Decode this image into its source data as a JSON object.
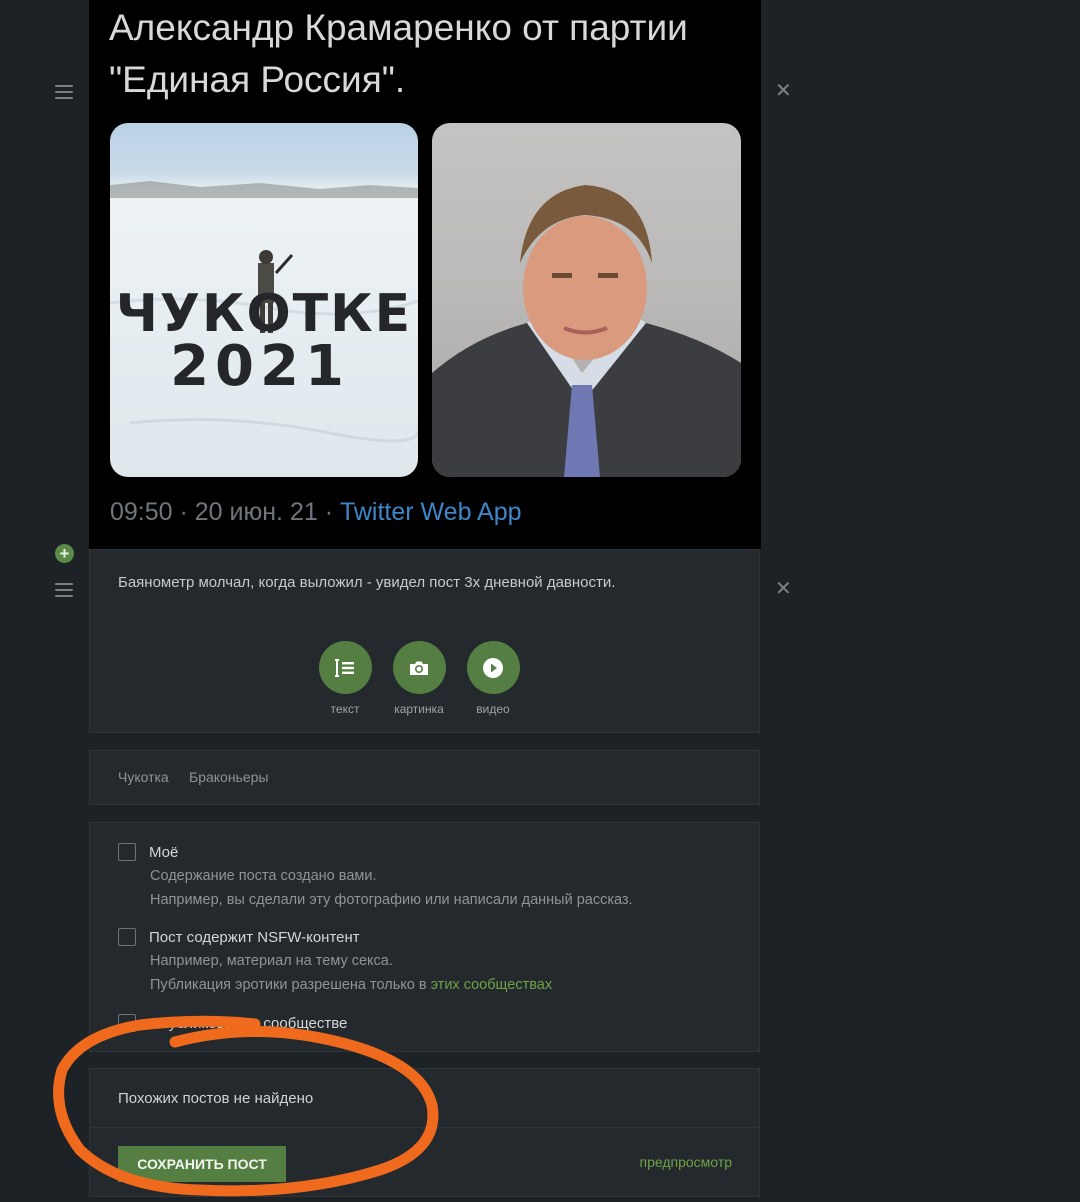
{
  "tweet": {
    "title": "Александр Крамаренко от партии \"Единая Россия\".",
    "left_photo_caption": "ЧУКОТКЕ 2021",
    "time_date": "09:50 · 20 июн. 21 · ",
    "source": "Twitter Web App"
  },
  "text_block": {
    "body": "Баянометр молчал, когда выложил - увидел пост 3х дневной давности."
  },
  "toolbar": {
    "buttons": [
      {
        "label": "текст",
        "icon": "text-icon"
      },
      {
        "label": "картинка",
        "icon": "camera-icon"
      },
      {
        "label": "видео",
        "icon": "play-icon"
      }
    ]
  },
  "tags": [
    "Чукотка",
    "Браконьеры"
  ],
  "options": {
    "mine_label": "Моё",
    "mine_desc_1": "Содержание поста создано вами.",
    "mine_desc_2": "Например, вы сделали эту фотографию или написали данный рассказ.",
    "nsfw_label": "Пост содержит NSFW-контент",
    "nsfw_desc_1": "Например, материал на тему секса.",
    "nsfw_desc_2_prefix": "Публикация эротики разрешена только в ",
    "nsfw_desc_2_link": "этих сообществах",
    "community_label": "Опубликовать в сообществе"
  },
  "similar": {
    "message": "Похожих постов не найдено"
  },
  "actions": {
    "save_label": "СОХРАНИТЬ ПОСТ",
    "preview_label": "предпросмотр"
  },
  "colors": {
    "accent": "#557e43",
    "link": "#6ea245",
    "annotation": "#f06a1e"
  }
}
